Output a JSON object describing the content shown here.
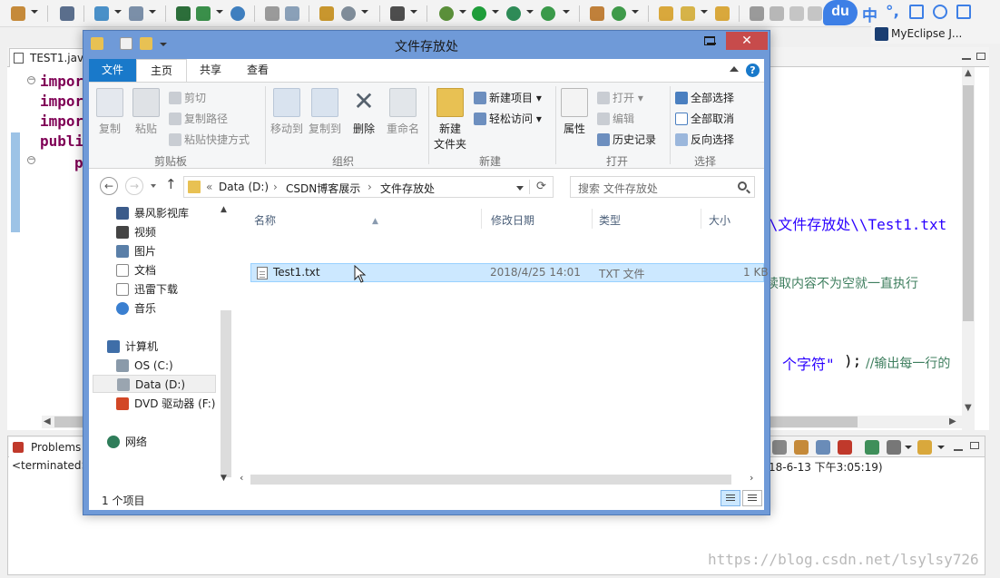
{
  "eclipse": {
    "perspective": "MyEclipse J...",
    "editor_tab": "TEST1.java",
    "code": {
      "line1": "impor",
      "line2": "impor",
      "line3": "impor",
      "line4": "publi",
      "line5": "p",
      "str_path": "\\\\文件存放处\\\\Test1.txt",
      "comment_read": "读取内容不为空就一直执行",
      "str_char_pre": "+\"",
      "str_char": "个字符\"",
      "str_char_post": ");",
      "comment_output": "//输出每一行的"
    },
    "console": {
      "tab": "Problems",
      "status_left": "<terminated>",
      "status_right": "18-6-13 下午3:05:19)"
    },
    "watermark": "https://blog.csdn.net/lsylsy726"
  },
  "ime": {
    "logo": "du",
    "lang": "中",
    "punct": "°,"
  },
  "explorer": {
    "title": "文件存放处",
    "tabs": {
      "file": "文件",
      "home": "主页",
      "share": "共享",
      "view": "查看"
    },
    "ribbon": {
      "copy": "复制",
      "paste": "粘贴",
      "cut": "剪切",
      "copy_path": "复制路径",
      "paste_shortcut": "粘贴快捷方式",
      "group_clipboard": "剪贴板",
      "move_to": "移动到",
      "copy_to": "复制到",
      "delete": "删除",
      "rename": "重命名",
      "group_organize": "组织",
      "new_folder_line1": "新建",
      "new_folder_line2": "文件夹",
      "new_item": "新建项目",
      "easy_access": "轻松访问",
      "group_new": "新建",
      "properties": "属性",
      "open": "打开",
      "edit": "编辑",
      "history": "历史记录",
      "group_open": "打开",
      "select_all": "全部选择",
      "select_none": "全部取消",
      "invert_selection": "反向选择",
      "group_select": "选择"
    },
    "address": {
      "prefix": "«",
      "seg1": "Data (D:)",
      "sep1": "›",
      "seg2": "CSDN博客展示",
      "sep2": "›",
      "seg3": "文件存放处"
    },
    "search_placeholder": "搜索 文件存放处",
    "nav": {
      "baofeng": "暴风影视库",
      "video": "视频",
      "pictures": "图片",
      "documents": "文档",
      "xunlei": "迅雷下载",
      "music": "音乐",
      "computer": "计算机",
      "os": "OS (C:)",
      "data": "Data (D:)",
      "dvd": "DVD 驱动器 (F:)",
      "network": "网络"
    },
    "columns": {
      "name": "名称",
      "modified": "修改日期",
      "type": "类型",
      "size": "大小"
    },
    "files": [
      {
        "name": "Test1.txt",
        "modified": "2018/4/25 14:01",
        "type": "TXT 文件",
        "size": "1 KB"
      }
    ],
    "status": "1 个项目"
  }
}
